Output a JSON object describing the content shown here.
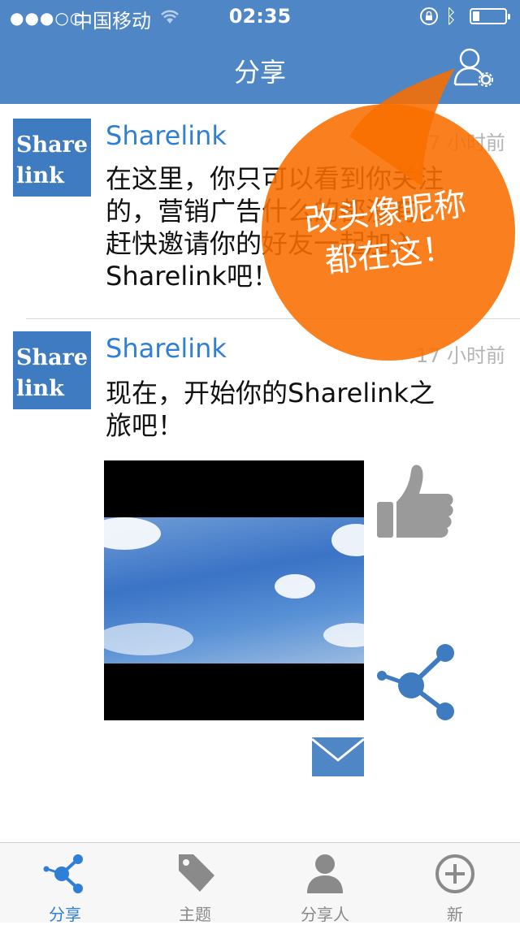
{
  "status_bar": {
    "signal": "●●●○○",
    "carrier": "中国移动",
    "time": "02:35",
    "battery_level": 0.2
  },
  "nav": {
    "title": "分享"
  },
  "posts": [
    {
      "avatar_line1": "Share",
      "avatar_line2": "link",
      "author": "Sharelink",
      "ago": "17 小时前",
      "text": "在这里，你只可以看到你关注的，营销广告什么的都没有，赶快邀请你的好友一起加入Sharelink吧！"
    },
    {
      "avatar_line1": "Share",
      "avatar_line2": "link",
      "author": "Sharelink",
      "ago": "17 小时前",
      "text": "现在，开始你的Sharelink之旅吧！"
    }
  ],
  "overlay": {
    "line1": "改头像昵称",
    "line2": "都在这！"
  },
  "tabs": [
    {
      "label": "分享",
      "icon": "share-icon"
    },
    {
      "label": "主题",
      "icon": "tag-icon"
    },
    {
      "label": "分享人",
      "icon": "person-icon"
    },
    {
      "label": "新",
      "icon": "plus-circle-icon"
    }
  ],
  "colors": {
    "nav": "#4e86c6",
    "accent": "#2f7fd6",
    "overlay": "#f96e00",
    "tab_inactive": "#8a8a8a"
  }
}
